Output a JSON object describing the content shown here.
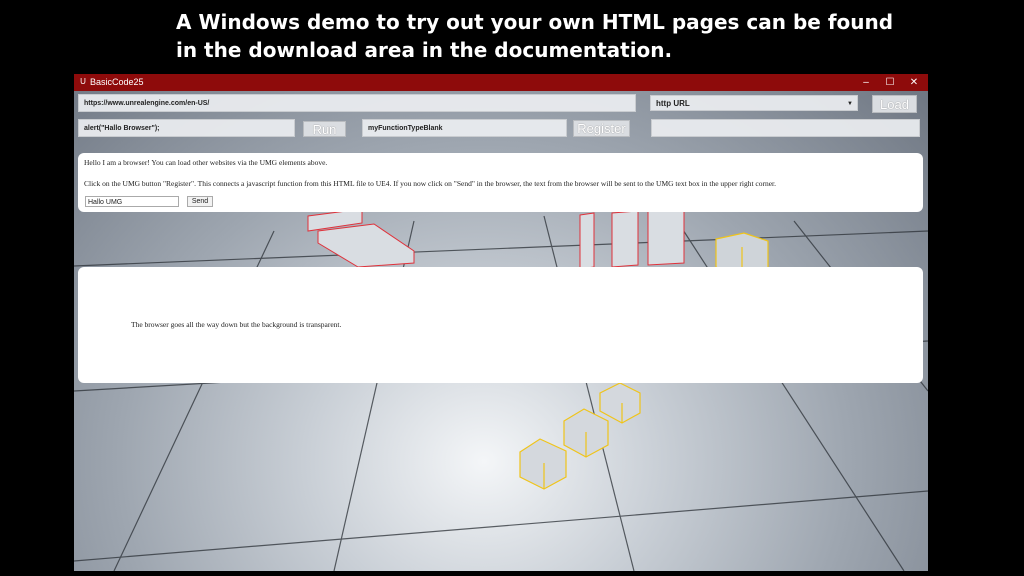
{
  "caption": {
    "line1": "A Windows demo to try out your own HTML pages can be found",
    "line2": "in the download area in the documentation."
  },
  "window": {
    "title": "BasicCode25",
    "minimize": "–",
    "maximize": "☐",
    "close": "✕"
  },
  "toolbar": {
    "url_value": "https://www.unrealengine.com/en-US/",
    "url_type": "http URL",
    "load_label": "Load",
    "js_value": "alert(\"Hallo Browser\");",
    "run_label": "Run",
    "function_value": "myFunctionTypeBlank",
    "register_label": "Register",
    "output_value": ""
  },
  "browser_panel": {
    "line1": "Hello I am a browser! You can load other websites via the UMG elements above.",
    "line2": "Click on the UMG button \"Register\". This connects a javascript function from this HTML file to UE4. If you now click on \"Send\" in the browser, the text from the browser will be sent to the UMG text box in the upper right corner.",
    "input_value": "Hallo UMG",
    "send_label": "Send"
  },
  "transparent_panel": {
    "text": "The browser goes all the way down but the background is transparent."
  },
  "colors": {
    "titlebar": "#8e0b0b",
    "outline_red": "#e0313a",
    "outline_yellow": "#f0c419"
  }
}
